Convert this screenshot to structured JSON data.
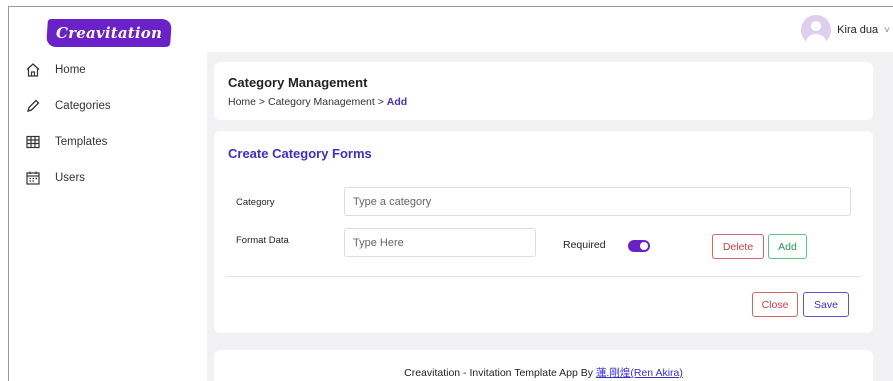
{
  "header": {
    "logo_text": "Creavitation",
    "user_name": "Kira dua",
    "user_menu_caret": "˅"
  },
  "sidebar": {
    "items": [
      {
        "label": "Home",
        "icon": "home-icon"
      },
      {
        "label": "Categories",
        "icon": "pen-icon"
      },
      {
        "label": "Templates",
        "icon": "grid-icon"
      },
      {
        "label": "Users",
        "icon": "calendar-icon"
      }
    ]
  },
  "page": {
    "title": "Category Management",
    "breadcrumb": {
      "home": "Home",
      "sep1": " > ",
      "section": "Category Management",
      "sep2": " > ",
      "current": "Add"
    }
  },
  "form": {
    "title": "Create Category Forms",
    "category_label": "Category",
    "category_placeholder": "Type a category",
    "format_label": "Format Data",
    "format_placeholder": "Type Here",
    "required_label": "Required",
    "required_on": true,
    "delete_label": "Delete",
    "add_label": "Add",
    "close_label": "Close",
    "save_label": "Save"
  },
  "footer": {
    "text": "Creavitation - Invitation Template App By ",
    "author_link": "蓮.剛煌(Ren Akira)"
  },
  "colors": {
    "brand": "#6b21c8",
    "accent": "#3a2fd0",
    "danger": "#d13c46",
    "success": "#2a9a56"
  }
}
